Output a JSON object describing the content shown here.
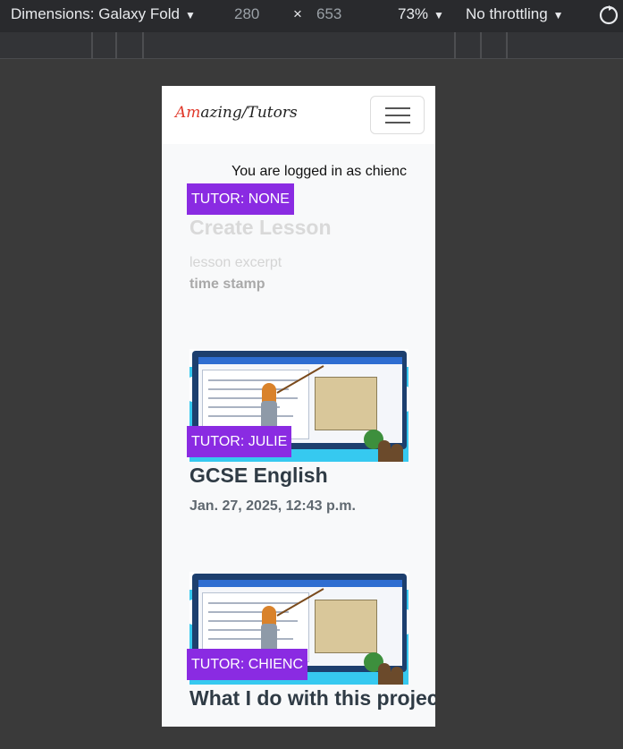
{
  "devtools": {
    "dimensions_label": "Dimensions: Galaxy Fold",
    "width_value": "280",
    "times_symbol": "×",
    "height_value": "653",
    "zoom": "73%",
    "throttling": "No throttling",
    "caret": "▼",
    "rotate_icon": "rotate-icon"
  },
  "navbar": {
    "brand_accent": "Am",
    "brand_rest": "azing/Tutors",
    "toggler_icon": "hamburger-icon"
  },
  "session": {
    "logged_in_text": "You are logged in as chienc"
  },
  "lessons": [
    {
      "tutor": "TUTOR: NONE",
      "title": "Create Lesson",
      "excerpt": "lesson excerpt",
      "timestamp": "time stamp"
    },
    {
      "tutor": "TUTOR: JULIE",
      "title": "GCSE English",
      "timestamp": "Jan. 27, 2025, 12:43 p.m."
    },
    {
      "tutor": "TUTOR: CHIENC",
      "title": "What I do with this project"
    }
  ],
  "colors": {
    "badge": "#8a2be2",
    "brand_accent": "#e0392b",
    "page_bg": "#f8f9fa"
  }
}
